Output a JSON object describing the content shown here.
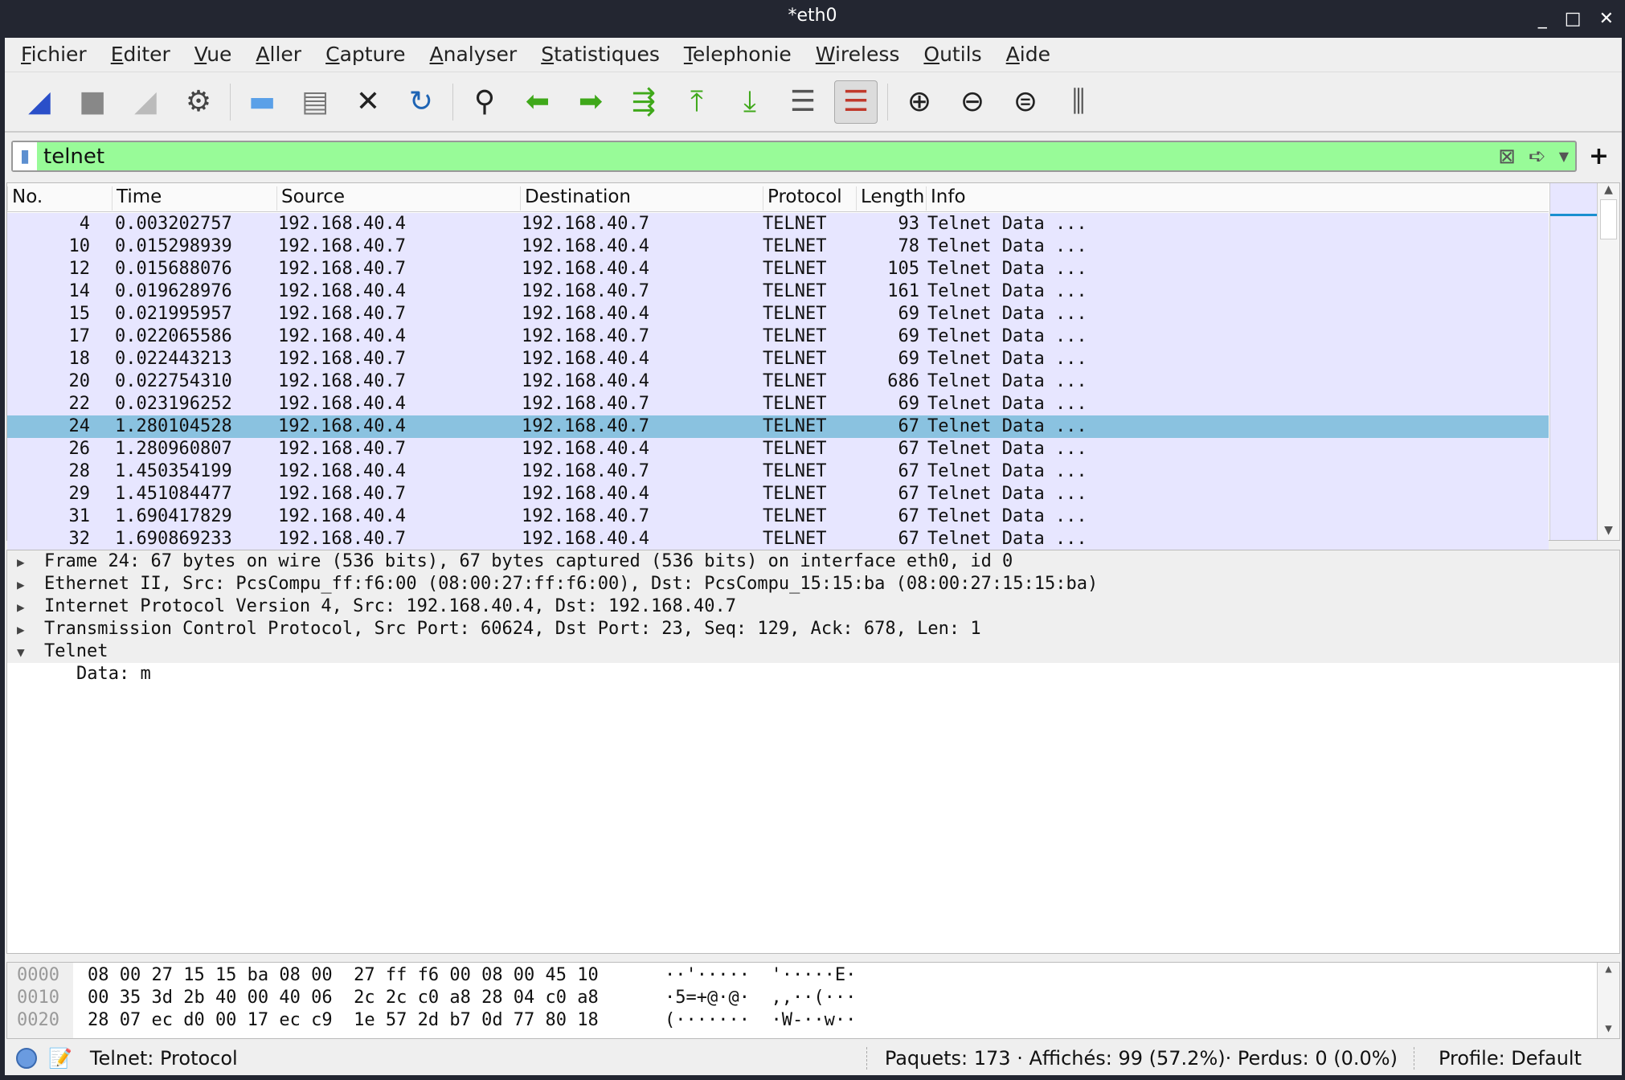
{
  "window": {
    "title": "*eth0",
    "controls": [
      "_",
      "□",
      "✕"
    ]
  },
  "menu": [
    "Fichier",
    "Editer",
    "Vue",
    "Aller",
    "Capture",
    "Analyser",
    "Statistiques",
    "Telephonie",
    "Wireless",
    "Outils",
    "Aide"
  ],
  "toolbar": [
    {
      "name": "start-capture-icon",
      "glyph": "◢",
      "color": "#2a4fc9"
    },
    {
      "name": "stop-capture-icon",
      "glyph": "■",
      "color": "#888"
    },
    {
      "name": "restart-capture-icon",
      "glyph": "◢",
      "color": "#bbb"
    },
    {
      "name": "capture-options-icon",
      "glyph": "⚙",
      "color": "#444"
    },
    {
      "sep": true
    },
    {
      "name": "open-file-icon",
      "glyph": "▬",
      "color": "#5aa0e8"
    },
    {
      "name": "save-file-icon",
      "glyph": "▤",
      "color": "#777"
    },
    {
      "name": "close-file-icon",
      "glyph": "✕",
      "color": "#222"
    },
    {
      "name": "reload-file-icon",
      "glyph": "↻",
      "color": "#1e64b4"
    },
    {
      "sep": true
    },
    {
      "name": "find-packet-icon",
      "glyph": "⚲",
      "color": "#222"
    },
    {
      "name": "go-back-icon",
      "glyph": "⬅",
      "color": "#3fa81a"
    },
    {
      "name": "go-forward-icon",
      "glyph": "➡",
      "color": "#3fa81a"
    },
    {
      "name": "go-to-packet-icon",
      "glyph": "⇶",
      "color": "#3fa81a"
    },
    {
      "name": "first-packet-icon",
      "glyph": "⤒",
      "color": "#3fa81a"
    },
    {
      "name": "last-packet-icon",
      "glyph": "⤓",
      "color": "#3fa81a"
    },
    {
      "name": "autoscroll-icon",
      "glyph": "☰",
      "color": "#555"
    },
    {
      "name": "colorize-icon",
      "glyph": "☰",
      "color": "#c0392b",
      "active": true
    },
    {
      "sep": true
    },
    {
      "name": "zoom-in-icon",
      "glyph": "⊕",
      "color": "#222"
    },
    {
      "name": "zoom-out-icon",
      "glyph": "⊖",
      "color": "#222"
    },
    {
      "name": "zoom-normal-icon",
      "glyph": "⊜",
      "color": "#222"
    },
    {
      "name": "resize-columns-icon",
      "glyph": "⫼",
      "color": "#555"
    }
  ],
  "filter": {
    "value": "telnet",
    "bg": "#98fb98"
  },
  "packet_list": {
    "columns": [
      "No.",
      "Time",
      "Source",
      "Destination",
      "Protocol",
      "Length",
      "Info"
    ],
    "rows": [
      [
        "4",
        "0.003202757",
        "192.168.40.4",
        "192.168.40.7",
        "TELNET",
        "93",
        "Telnet Data ..."
      ],
      [
        "10",
        "0.015298939",
        "192.168.40.7",
        "192.168.40.4",
        "TELNET",
        "78",
        "Telnet Data ..."
      ],
      [
        "12",
        "0.015688076",
        "192.168.40.7",
        "192.168.40.4",
        "TELNET",
        "105",
        "Telnet Data ..."
      ],
      [
        "14",
        "0.019628976",
        "192.168.40.4",
        "192.168.40.7",
        "TELNET",
        "161",
        "Telnet Data ..."
      ],
      [
        "15",
        "0.021995957",
        "192.168.40.7",
        "192.168.40.4",
        "TELNET",
        "69",
        "Telnet Data ..."
      ],
      [
        "17",
        "0.022065586",
        "192.168.40.4",
        "192.168.40.7",
        "TELNET",
        "69",
        "Telnet Data ..."
      ],
      [
        "18",
        "0.022443213",
        "192.168.40.7",
        "192.168.40.4",
        "TELNET",
        "69",
        "Telnet Data ..."
      ],
      [
        "20",
        "0.022754310",
        "192.168.40.7",
        "192.168.40.4",
        "TELNET",
        "686",
        "Telnet Data ..."
      ],
      [
        "22",
        "0.023196252",
        "192.168.40.4",
        "192.168.40.7",
        "TELNET",
        "69",
        "Telnet Data ..."
      ],
      [
        "24",
        "1.280104528",
        "192.168.40.4",
        "192.168.40.7",
        "TELNET",
        "67",
        "Telnet Data ..."
      ],
      [
        "26",
        "1.280960807",
        "192.168.40.7",
        "192.168.40.4",
        "TELNET",
        "67",
        "Telnet Data ..."
      ],
      [
        "28",
        "1.450354199",
        "192.168.40.4",
        "192.168.40.7",
        "TELNET",
        "67",
        "Telnet Data ..."
      ],
      [
        "29",
        "1.451084477",
        "192.168.40.7",
        "192.168.40.4",
        "TELNET",
        "67",
        "Telnet Data ..."
      ],
      [
        "31",
        "1.690417829",
        "192.168.40.4",
        "192.168.40.7",
        "TELNET",
        "67",
        "Telnet Data ..."
      ],
      [
        "32",
        "1.690869233",
        "192.168.40.7",
        "192.168.40.4",
        "TELNET",
        "67",
        "Telnet Data ..."
      ]
    ],
    "selected_no": "24",
    "row_color": "#e7e6ff",
    "selected_color": "#8ac2e0"
  },
  "details": [
    {
      "text": "Frame 24: 67 bytes on wire (536 bits), 67 bytes captured (536 bits) on interface eth0, id 0",
      "expanded": false
    },
    {
      "text": "Ethernet II, Src: PcsCompu_ff:f6:00 (08:00:27:ff:f6:00), Dst: PcsCompu_15:15:ba (08:00:27:15:15:ba)",
      "expanded": false
    },
    {
      "text": "Internet Protocol Version 4, Src: 192.168.40.4, Dst: 192.168.40.7",
      "expanded": false
    },
    {
      "text": "Transmission Control Protocol, Src Port: 60624, Dst Port: 23, Seq: 129, Ack: 678, Len: 1",
      "expanded": false
    },
    {
      "text": "Telnet",
      "expanded": true
    },
    {
      "text": "Data: m",
      "child": true
    }
  ],
  "hex": [
    {
      "offset": "0000",
      "bytes": "08 00 27 15 15 ba 08 00  27 ff f6 00 08 00 45 10",
      "ascii": "··'·····  '·····E·"
    },
    {
      "offset": "0010",
      "bytes": "00 35 3d 2b 40 00 40 06  2c 2c c0 a8 28 04 c0 a8",
      "ascii": "·5=+@·@·  ,,··(···"
    },
    {
      "offset": "0020",
      "bytes": "28 07 ec d0 00 17 ec c9  1e 57 2d b7 0d 77 80 18",
      "ascii": "(·······  ·W-··w··"
    }
  ],
  "status": {
    "field": "Telnet: Protocol",
    "counts": "Paquets: 173 · Affichés: 99 (57.2%)· Perdus: 0 (0.0%)",
    "profile": "Profile: Default"
  }
}
